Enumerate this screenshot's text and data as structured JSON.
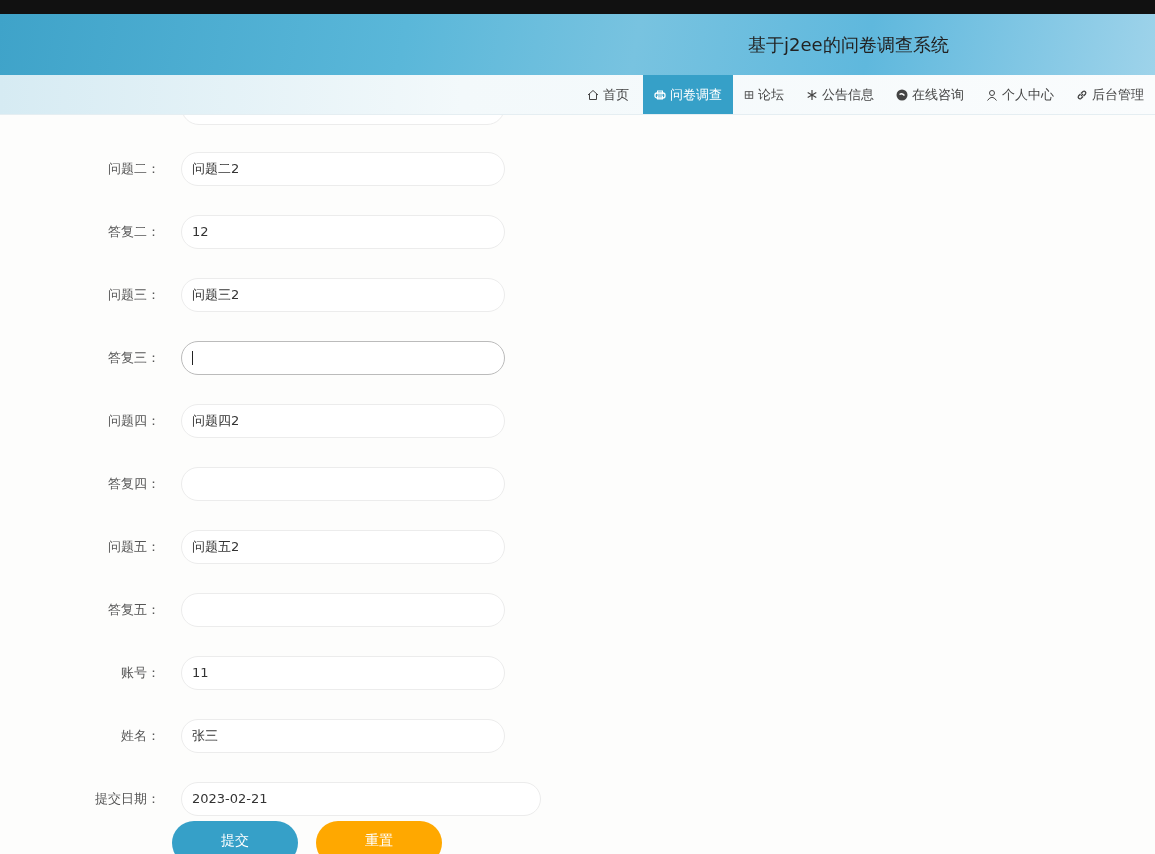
{
  "site_title": "基于j2ee的问卷调查系统",
  "nav": [
    {
      "label": "首页",
      "selected": false
    },
    {
      "label": "问卷调查",
      "selected": true
    },
    {
      "label": "论坛",
      "selected": false
    },
    {
      "label": "公告信息",
      "selected": false
    },
    {
      "label": "在线咨询",
      "selected": false
    },
    {
      "label": "个人中心",
      "selected": false
    },
    {
      "label": "后台管理",
      "selected": false
    }
  ],
  "fields": [
    {
      "label": "问题二：",
      "value": "问题二2",
      "focused": false,
      "kind": "text"
    },
    {
      "label": "答复二：",
      "value": "12",
      "focused": false,
      "kind": "text"
    },
    {
      "label": "问题三：",
      "value": "问题三2",
      "focused": false,
      "kind": "text"
    },
    {
      "label": "答复三：",
      "focused": true,
      "kind": "text"
    },
    {
      "label": "问题四：",
      "value": "问题四2",
      "focused": false,
      "kind": "text"
    },
    {
      "label": "答复四：",
      "focused": false,
      "kind": "text"
    },
    {
      "label": "问题五：",
      "value": "问题五2",
      "focused": false,
      "kind": "text"
    },
    {
      "label": "答复五：",
      "focused": false,
      "kind": "text"
    },
    {
      "label": "账号：",
      "value": "11",
      "focused": false,
      "kind": "text"
    },
    {
      "label": "姓名：",
      "value": "张三",
      "focused": false,
      "kind": "text"
    },
    {
      "label": "提交日期：",
      "value": "2023-02-21",
      "focused": false,
      "kind": "date"
    }
  ],
  "buttons": [
    {
      "label": "提交",
      "kind": "submit"
    },
    {
      "label": "重置",
      "kind": "reset"
    }
  ]
}
